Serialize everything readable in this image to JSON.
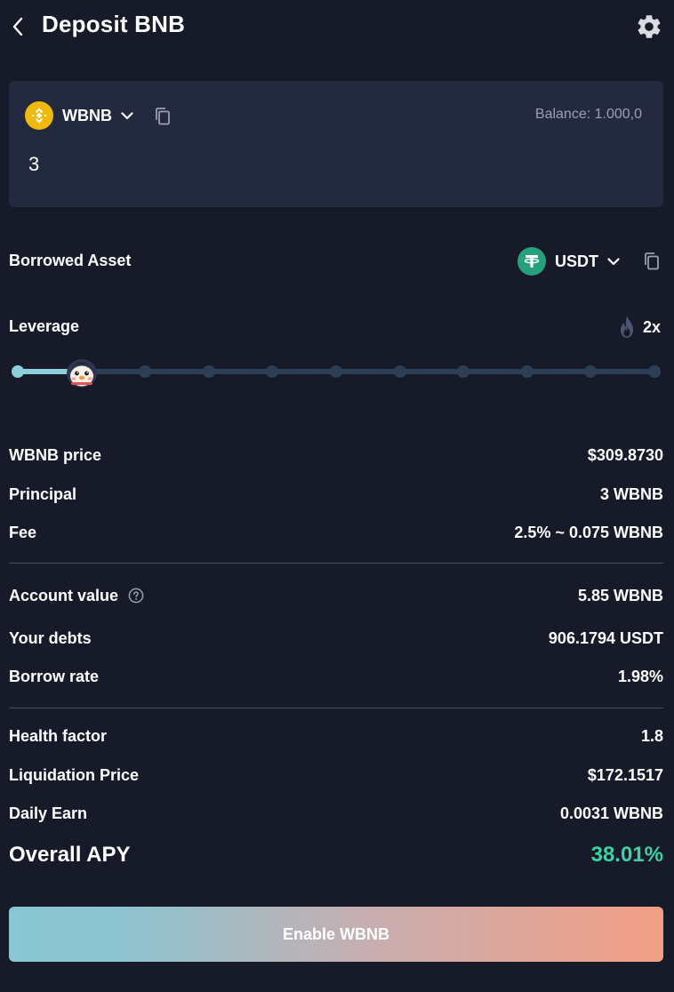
{
  "header": {
    "title": "Deposit BNB"
  },
  "deposit": {
    "token": "WBNB",
    "balance": "Balance: 1.000,0",
    "amount": "3"
  },
  "borrowed": {
    "label": "Borrowed Asset",
    "token": "USDT"
  },
  "leverage": {
    "label": "Leverage",
    "value": "2x",
    "steps": 10,
    "selected_step": 1
  },
  "info": {
    "wbnb_price_label": "WBNB price",
    "wbnb_price": "$309.8730",
    "principal_label": "Principal",
    "principal": "3 WBNB",
    "fee_label": "Fee",
    "fee": "2.5% ~ 0.075 WBNB",
    "account_value_label": "Account value",
    "account_value": "5.85 WBNB",
    "debts_label": "Your debts",
    "debts": "906.1794 USDT",
    "borrow_rate_label": "Borrow rate",
    "borrow_rate": "1.98%",
    "health_label": "Health factor",
    "health": "1.8",
    "liq_label": "Liquidation Price",
    "liq": "$172.1517",
    "daily_label": "Daily Earn",
    "daily": "0.0031 WBNB",
    "apy_label": "Overall APY",
    "apy": "38.01%"
  },
  "cta": {
    "label": "Enable WBNB"
  },
  "colors": {
    "background": "#171b29",
    "card": "#232a40",
    "apy": "#3bd3a2",
    "bnb": "#f0b90b",
    "usdt": "#26a17b"
  },
  "icons": [
    "back-arrow-icon",
    "gear-icon",
    "bnb-logo-icon",
    "chevron-down-icon",
    "copy-icon",
    "usdt-logo-icon",
    "flame-icon",
    "penguin-thumb-icon",
    "help-circle-icon"
  ]
}
